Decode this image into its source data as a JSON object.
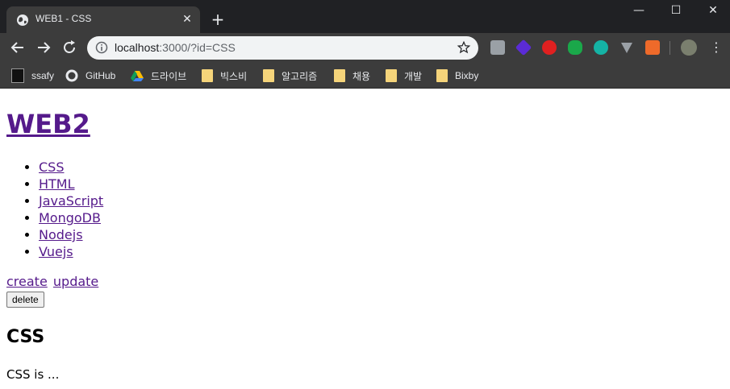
{
  "browser": {
    "tab_title": "WEB1 - CSS",
    "url_host": "localhost",
    "url_rest": ":3000/?id=CSS",
    "bookmarks": [
      "ssafy",
      "GitHub",
      "드라이브",
      "빅스비",
      "알고리즘",
      "채용",
      "개발",
      "Bixby"
    ],
    "extensions": [
      "ext-1-icon",
      "ext-2-icon",
      "ext-3-icon",
      "ext-4-icon",
      "ext-5-icon",
      "ext-6-icon",
      "ext-7-icon"
    ]
  },
  "page": {
    "title": "WEB2",
    "topics": [
      "CSS",
      "HTML",
      "JavaScript",
      "MongoDB",
      "Nodejs",
      "Vuejs"
    ],
    "create_label": "create",
    "update_label": "update",
    "delete_label": "delete",
    "article_title": "CSS",
    "article_body": "CSS is ..."
  },
  "colors": {
    "link": "#551a8b",
    "chrome_dark": "#202124",
    "chrome_toolbar": "#3c3c3c"
  }
}
